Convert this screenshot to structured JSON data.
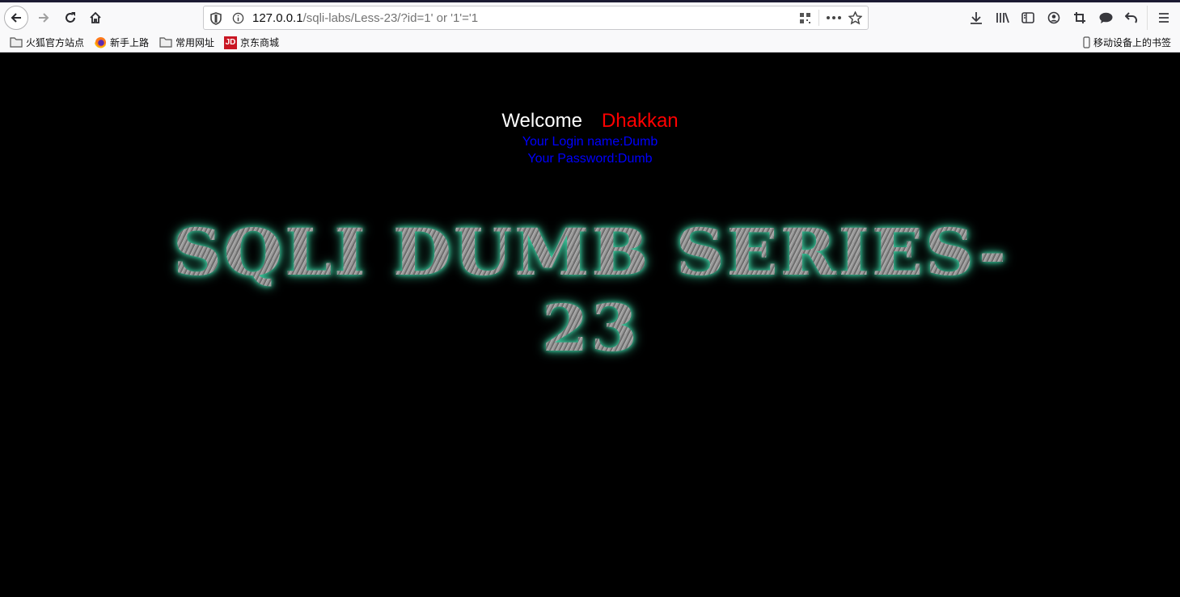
{
  "browser": {
    "url_host": "127.0.0.1",
    "url_path": "/sqli-labs/Less-23/?id=1' or '1'='1",
    "bookmarks": [
      {
        "label": "火狐官方站点",
        "icon": "folder-icon"
      },
      {
        "label": "新手上路",
        "icon": "firefox-icon"
      },
      {
        "label": "常用网址",
        "icon": "folder-icon"
      },
      {
        "label": "京东商城",
        "icon": "jd-icon",
        "icon_text": "JD"
      }
    ],
    "mobile_bookmarks": "移动设备上的书签"
  },
  "page": {
    "welcome": "Welcome",
    "username": "Dhakkan",
    "login_name": "Your Login name:Dumb",
    "password": "Your Password:Dumb",
    "banner": "SQLI DUMB SERIES-23"
  },
  "colors": {
    "username": "#ff0000",
    "info": "#0000ff",
    "glow": "#3fd6a8"
  }
}
